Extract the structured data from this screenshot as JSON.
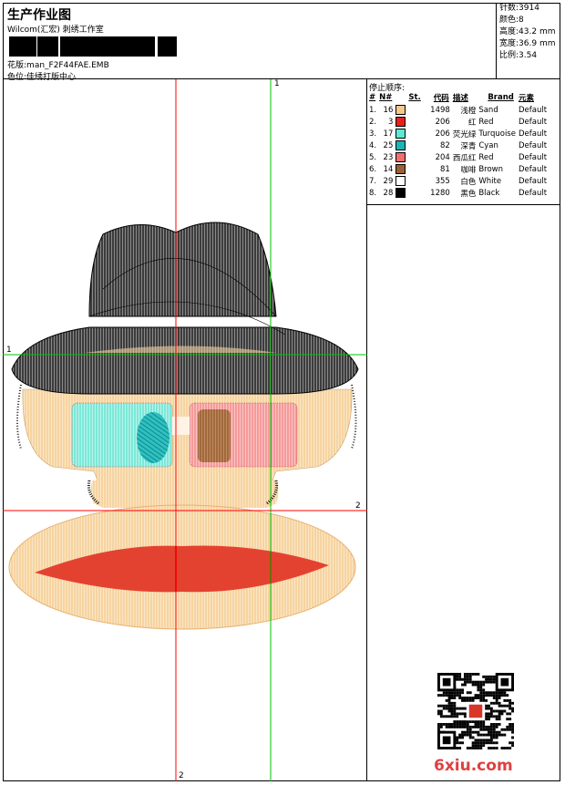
{
  "header": {
    "title": "生产作业图",
    "company": "Wilcom(汇宏) 刺绣工作室",
    "design_label": "花版:",
    "design_file": "man_F2F44FAE.EMB",
    "colorway_label": "色位:",
    "colorway_value": "佳绣打版中心"
  },
  "stats": [
    {
      "label": "针数:",
      "value": "3914"
    },
    {
      "label": "颜色:",
      "value": "8"
    },
    {
      "label": "高度:",
      "value": "43.2 mm"
    },
    {
      "label": "宽度:",
      "value": "36.9 mm"
    },
    {
      "label": "比例:",
      "value": "3.54"
    }
  ],
  "legend": {
    "title": "停止顺序:",
    "columns": [
      "#",
      "N#",
      "St.",
      "代码",
      "描述",
      "Brand",
      "元素"
    ],
    "rows": [
      {
        "idx": "1.",
        "n": "16",
        "color": "#F5C98A",
        "st": "1498",
        "code": "浅橙",
        "desc": "Sand",
        "brand": "Default"
      },
      {
        "idx": "2.",
        "n": "3",
        "color": "#E8201A",
        "st": "206",
        "code": "红",
        "desc": "Red",
        "brand": "Default"
      },
      {
        "idx": "3.",
        "n": "17",
        "color": "#5FE8D0",
        "st": "206",
        "code": "荧光绿",
        "desc": "Turquoise",
        "brand": "Default"
      },
      {
        "idx": "4.",
        "n": "25",
        "color": "#1BB5B8",
        "st": "82",
        "code": "深青",
        "desc": "Cyan",
        "brand": "Default"
      },
      {
        "idx": "5.",
        "n": "23",
        "color": "#F07070",
        "st": "204",
        "code": "西瓜红",
        "desc": "Red",
        "brand": "Default"
      },
      {
        "idx": "6.",
        "n": "14",
        "color": "#9A6035",
        "st": "81",
        "code": "咖啡",
        "desc": "Brown",
        "brand": "Default"
      },
      {
        "idx": "7.",
        "n": "29",
        "color": "#FFFFFF",
        "st": "355",
        "code": "白色",
        "desc": "White",
        "brand": "Default"
      },
      {
        "idx": "8.",
        "n": "28",
        "color": "#000000",
        "st": "1280",
        "code": "黑色",
        "desc": "Black",
        "brand": "Default"
      }
    ]
  },
  "guides": {
    "v1": "1",
    "h1": "1",
    "h2": "2",
    "v2": "2"
  },
  "watermark": {
    "site": "6xiu.com"
  }
}
